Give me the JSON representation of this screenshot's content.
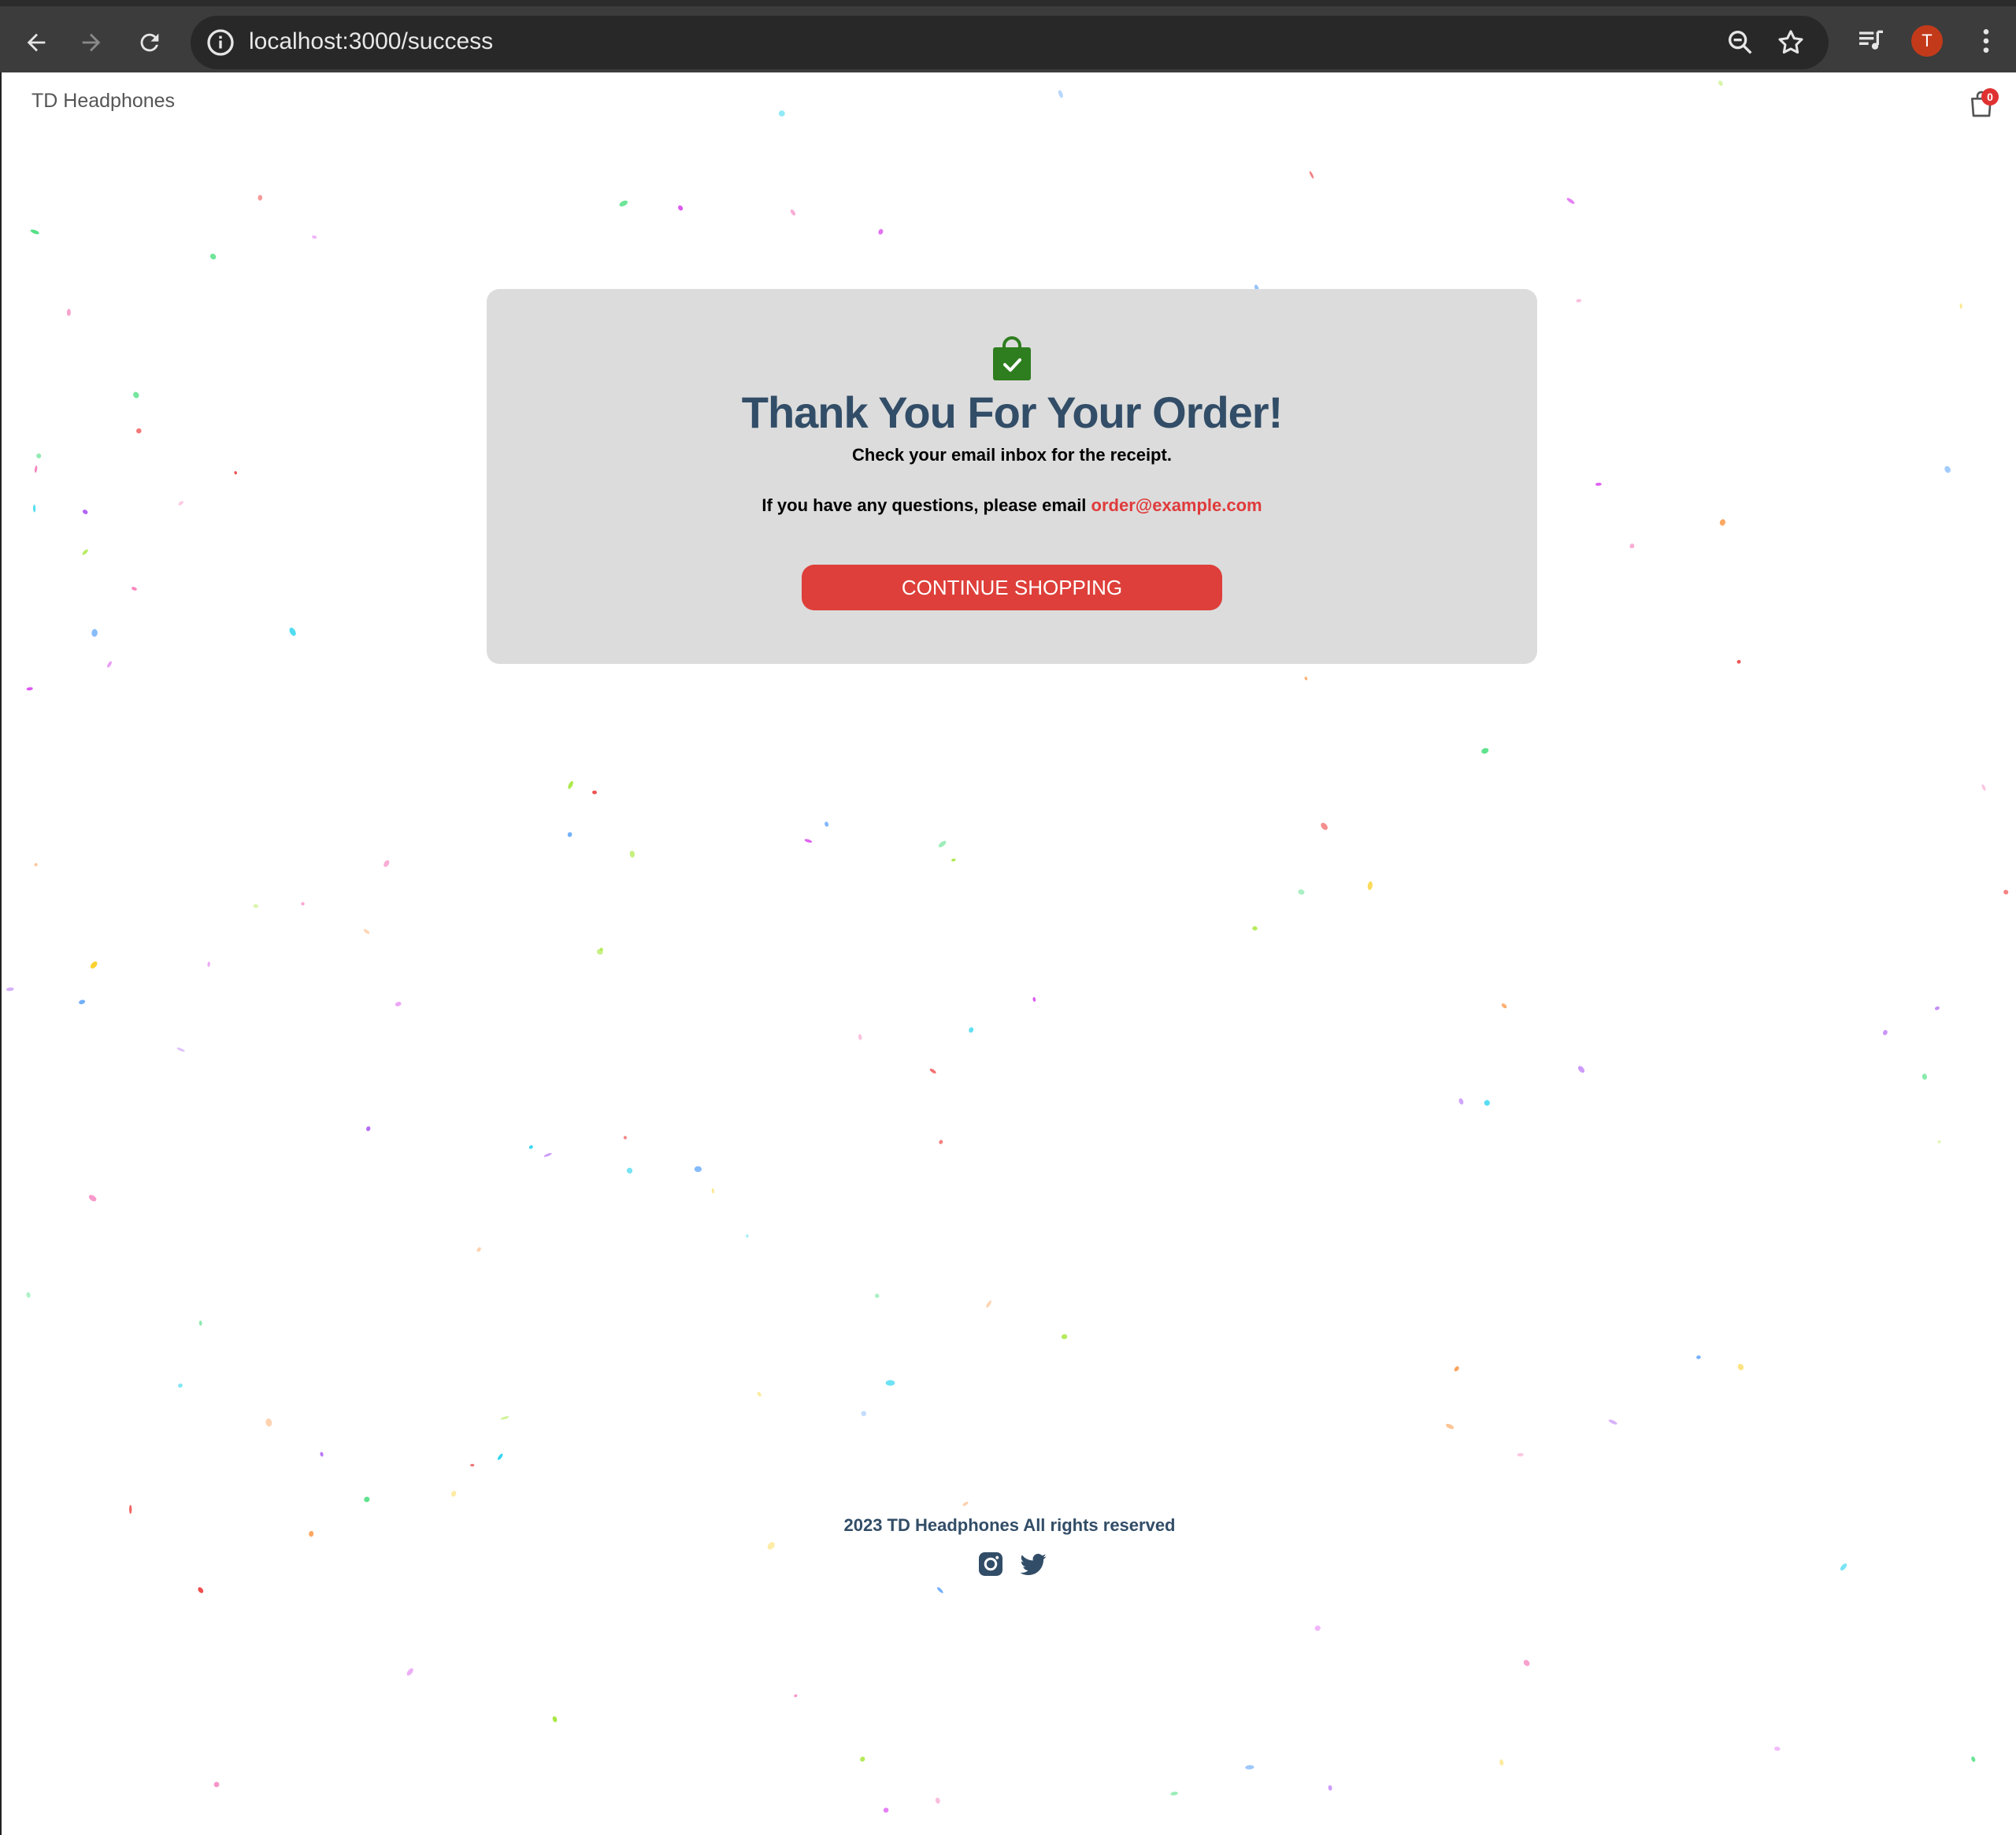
{
  "browser": {
    "url": "localhost:3000/success",
    "profile_initial": "T",
    "icons": [
      "back-icon",
      "forward-icon",
      "reload-icon",
      "info-icon",
      "zoom-out-icon",
      "star-icon",
      "media-playlist-icon",
      "more-vert-icon"
    ]
  },
  "header": {
    "brand": "TD Headphones",
    "cart_count": "0"
  },
  "success": {
    "title": "Thank You For Your Order!",
    "subtitle": "Check your email inbox for the receipt.",
    "question_prefix": "If you have any questions, please email ",
    "email": "order@example.com",
    "button_label": "CONTINUE SHOPPING"
  },
  "footer": {
    "text": "2023 TD Headphones All rights reserved",
    "social_icons": [
      "instagram-icon",
      "twitter-icon"
    ]
  },
  "colors": {
    "accent_red": "#de3f3a",
    "heading": "#324d67",
    "card_bg": "#dcdcdc",
    "bag_green": "#2e7d1f"
  }
}
